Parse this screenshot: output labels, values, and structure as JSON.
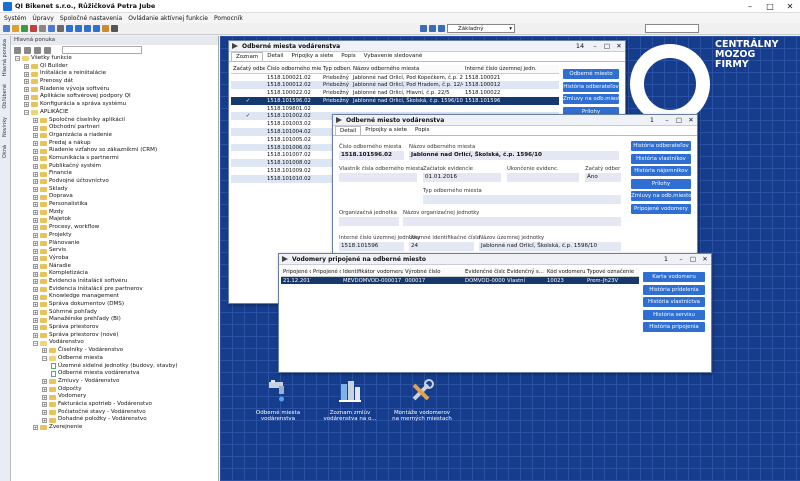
{
  "app": {
    "title": "QI Bikenet s.r.o., Růžičková Petra Jube"
  },
  "menu": [
    "Systém",
    "Úpravy",
    "Spoločné nastavenia",
    "Ovládanie aktívnej funkcie",
    "Pomocník"
  ],
  "toolbar": {
    "profile": "Základný"
  },
  "sidestrip": [
    "Hlavná ponuka",
    "Obľúbené",
    "Novinky",
    "Okná"
  ],
  "nav": {
    "header": "Hlavná ponuka",
    "items": [
      {
        "level": 0,
        "label": "Všetky funkcie",
        "type": "open"
      },
      {
        "level": 1,
        "label": "QI Builder",
        "type": "folder"
      },
      {
        "level": 1,
        "label": "Inštalácie a reinštalácie",
        "type": "folder"
      },
      {
        "level": 1,
        "label": "Prenosy dát",
        "type": "folder"
      },
      {
        "level": 1,
        "label": "Riadenie vývoja softvéru",
        "type": "folder"
      },
      {
        "level": 1,
        "label": "Aplikácie softvérovej podpory QI",
        "type": "folder"
      },
      {
        "level": 1,
        "label": "Konfigurácia a správa systému",
        "type": "folder"
      },
      {
        "level": 1,
        "label": "APLIKÁCIE",
        "type": "open"
      },
      {
        "level": 2,
        "label": "Spoločné číselníky aplikácií",
        "type": "folder"
      },
      {
        "level": 2,
        "label": "Obchodní partneri",
        "type": "folder"
      },
      {
        "level": 2,
        "label": "Organizácia a riadenie",
        "type": "folder"
      },
      {
        "level": 2,
        "label": "Predaj a nákup",
        "type": "folder"
      },
      {
        "level": 2,
        "label": "Riadenie vzťahov so zákazníkmi (CRM)",
        "type": "folder"
      },
      {
        "level": 2,
        "label": "Komunikácia s partnermi",
        "type": "folder"
      },
      {
        "level": 2,
        "label": "Publikačný systém",
        "type": "folder"
      },
      {
        "level": 2,
        "label": "Financie",
        "type": "folder"
      },
      {
        "level": 2,
        "label": "Podvojné účtovníctvo",
        "type": "folder"
      },
      {
        "level": 2,
        "label": "Sklady",
        "type": "folder"
      },
      {
        "level": 2,
        "label": "Doprava",
        "type": "folder"
      },
      {
        "level": 2,
        "label": "Personalistika",
        "type": "folder"
      },
      {
        "level": 2,
        "label": "Mzdy",
        "type": "folder"
      },
      {
        "level": 2,
        "label": "Majetok",
        "type": "folder"
      },
      {
        "level": 2,
        "label": "Procesy, workflow",
        "type": "folder"
      },
      {
        "level": 2,
        "label": "Projekty",
        "type": "folder"
      },
      {
        "level": 2,
        "label": "Plánovanie",
        "type": "folder"
      },
      {
        "level": 2,
        "label": "Servis",
        "type": "folder"
      },
      {
        "level": 2,
        "label": "Výroba",
        "type": "folder"
      },
      {
        "level": 2,
        "label": "Náradie",
        "type": "folder"
      },
      {
        "level": 2,
        "label": "Kompletizácia",
        "type": "folder"
      },
      {
        "level": 2,
        "label": "Evidencia inštalácií softvéru",
        "type": "folder"
      },
      {
        "level": 2,
        "label": "Evidencia inštalácií pre partnerov",
        "type": "folder"
      },
      {
        "level": 2,
        "label": "Knowledge management",
        "type": "folder"
      },
      {
        "level": 2,
        "label": "Správa dokumentov (DMS)",
        "type": "folder"
      },
      {
        "level": 2,
        "label": "Súhrnné pohľady",
        "type": "folder"
      },
      {
        "level": 2,
        "label": "Manažérske prehľady (BI)",
        "type": "folder"
      },
      {
        "level": 2,
        "label": "Správa priestorov",
        "type": "folder"
      },
      {
        "level": 2,
        "label": "Správa priestorov (nové)",
        "type": "folder"
      },
      {
        "level": 2,
        "label": "Vodárenstvo",
        "type": "open"
      },
      {
        "level": 3,
        "label": "Číselníky - Vodárenstvo",
        "type": "folder"
      },
      {
        "level": 3,
        "label": "Odberné miesta",
        "type": "open"
      },
      {
        "level": 4,
        "label": "Územné sídelné jednotky (budovy, stavby)",
        "type": "doc"
      },
      {
        "level": 4,
        "label": "Odberné miesta vodárenstva",
        "type": "doc"
      },
      {
        "level": 3,
        "label": "Zmluvy - Vodárenstvo",
        "type": "folder"
      },
      {
        "level": 3,
        "label": "Odpočty",
        "type": "folder"
      },
      {
        "level": 3,
        "label": "Vodomery",
        "type": "folder"
      },
      {
        "level": 3,
        "label": "Fakturácia spotrieb - Vodárenstvo",
        "type": "folder"
      },
      {
        "level": 3,
        "label": "Počiatočné stavy - Vodárenstvo",
        "type": "folder"
      },
      {
        "level": 3,
        "label": "Dohadné položky - Vodárenstvo",
        "type": "folder"
      },
      {
        "level": 2,
        "label": "Zverejnenie",
        "type": "folder"
      }
    ]
  },
  "logo": {
    "line1": "CENTRÁLNY",
    "line2": "MOZOG",
    "line3": "FIRMY"
  },
  "win1": {
    "title": "Odberné miesta vodárenstva",
    "count": "14",
    "tabs": [
      "Zoznam",
      "Detail",
      "Prípojky a siete",
      "Popis",
      "Vybavenie sledované"
    ],
    "columns": [
      "Začatý odber",
      "Číslo odberného miesta",
      "Typ odberu",
      "Názov odberného miesta",
      "Interné číslo územnej jedn."
    ],
    "rows": [
      {
        "chk": "",
        "num": "1518.100021.02",
        "typ": "Priebežný",
        "name": "Jablonné nad Orlicí, Pod Kopečkem, č.p. 21/145",
        "int": "1518.100021"
      },
      {
        "chk": "",
        "num": "1518.100012.02",
        "typ": "Priebežný",
        "name": "Jablonné nad Orlicí, Pod Hradem, č.p. 12/40",
        "int": "1518.100012"
      },
      {
        "chk": "",
        "num": "1518.100022.02",
        "typ": "Priebežný",
        "name": "Jablonné nad Orlicí, Hlavní, č.p. 22/5",
        "int": "1518.100022"
      },
      {
        "chk": "✓",
        "num": "1518.101596.02",
        "typ": "Priebežný",
        "name": "Jablonné nad Orlicí, Školská, č.p. 1596/10",
        "int": "1518.101596"
      },
      {
        "chk": "",
        "num": "1518.109801.02",
        "typ": "",
        "name": "",
        "int": ""
      },
      {
        "chk": "✓",
        "num": "1518.101002.02",
        "typ": "",
        "name": "",
        "int": ""
      },
      {
        "chk": "",
        "num": "1518.101003.02",
        "typ": "",
        "name": "",
        "int": ""
      },
      {
        "chk": "",
        "num": "1518.101004.02",
        "typ": "",
        "name": "",
        "int": ""
      },
      {
        "chk": "",
        "num": "1518.101005.02",
        "typ": "",
        "name": "",
        "int": ""
      },
      {
        "chk": "",
        "num": "1518.101006.02",
        "typ": "",
        "name": "",
        "int": ""
      },
      {
        "chk": "",
        "num": "1518.101007.02",
        "typ": "",
        "name": "",
        "int": ""
      },
      {
        "chk": "",
        "num": "1518.101008.02",
        "typ": "",
        "name": "",
        "int": ""
      },
      {
        "chk": "",
        "num": "1518.101009.02",
        "typ": "",
        "name": "",
        "int": ""
      },
      {
        "chk": "",
        "num": "1518.101010.02",
        "typ": "",
        "name": "",
        "int": ""
      }
    ],
    "buttons": [
      "Odberné miesto",
      "História odberateľov",
      "Zmluvy na odb.miesto",
      "Prílohy"
    ]
  },
  "win2": {
    "title": "Odberné miesto vodárenstva",
    "count": "1",
    "tabs": [
      "Detail",
      "Prípojky a siete",
      "Popis"
    ],
    "labels": {
      "num": "Číslo odberného miesta",
      "name": "Názov odberného miesta",
      "owner": "Vlastník čísla odberného miesta",
      "start": "Začiatok evidencie",
      "end": "Ukončenie evidenc.",
      "started": "Začatý odber",
      "type": "Typ odberného miesta",
      "org": "Organizačná jednotka",
      "orgname": "Názov organizačnej jednotky",
      "intnum": "Interné číslo územnej jednotky",
      "ident": "Územné identifikačné číslo",
      "unitname": "Názov územnej jednotky"
    },
    "values": {
      "num": "1518.101596.02",
      "name": "Jablonné nad Orlicí, Školská, č.p. 1596/10",
      "start": "01.01.2016",
      "started": "Áno",
      "intnum": "1518.101596",
      "ident": "24",
      "unitname": "Jablonné nad Orlicí, Školská, č.p. 1596/10"
    },
    "buttons": [
      "História odberateľov",
      "História vlastníkov",
      "História nájomníkov",
      "Prílohy",
      "Zmluvy na odb.miesto",
      "Pripojené vodomery"
    ]
  },
  "win3": {
    "title": "Vodomery pripojené na odberné miesto",
    "count": "1",
    "columns": [
      "Pripojené od",
      "Pripojené do",
      "Identifikátor vodomeru",
      "Výrobné číslo",
      "Evidenčné číslo",
      "Evidenčný s...",
      "Kód vodomeru",
      "Typové označenie"
    ],
    "rows": [
      {
        "od": "21.12.2017",
        "do": "",
        "id": "MEVDOMVOD-000017",
        "vyr": "000017",
        "evid": "DOMVOD-0000",
        "evs": "Vlastní",
        "kod": "10023",
        "typ": "Prem-Jh23V"
      }
    ],
    "buttons": [
      "Karta vodomeru",
      "História prídelenia",
      "História vlastníctva",
      "História servisu",
      "História pripojenia"
    ]
  },
  "tiles": [
    {
      "label": "Odberné miesta vodárenstva",
      "icon": "water-tap-icon"
    },
    {
      "label": "Zoznam zmlúv vodárenstva na o...",
      "icon": "contracts-icon"
    },
    {
      "label": "Montáže vodomerov na merných miestach",
      "icon": "tools-icon"
    }
  ]
}
